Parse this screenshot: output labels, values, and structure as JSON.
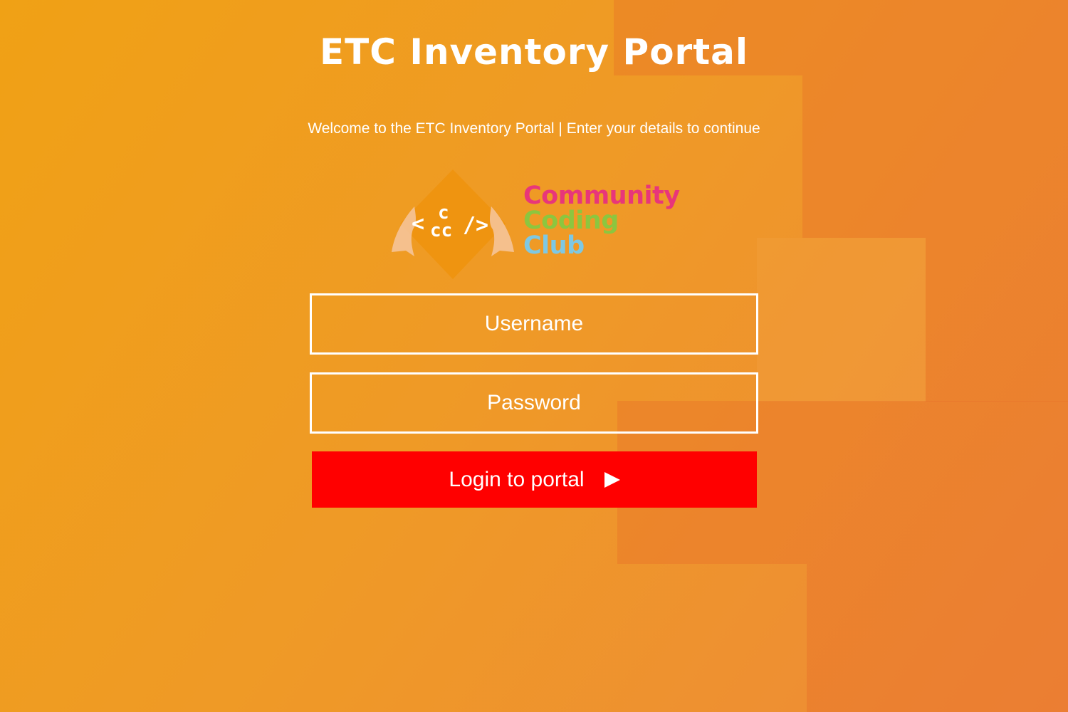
{
  "page": {
    "title": "ETC Inventory Portal",
    "subtitle": "Welcome to the ETC Inventory Portal | Enter your details to continue"
  },
  "logo": {
    "badge_text": "<ccc/>",
    "line1": "Community",
    "line2": "Coding",
    "line3": "Club"
  },
  "form": {
    "username_placeholder": "Username",
    "username_value": "",
    "password_placeholder": "Password",
    "password_value": "",
    "login_label": "Login to portal",
    "login_icon": "play-icon"
  },
  "colors": {
    "background_start": "#f0a115",
    "background_end": "#ee8a38",
    "login_button": "#ff0000",
    "logo_diamond": "#ef9410",
    "logo_community": "#e8367a",
    "logo_coding": "#8cc63f",
    "logo_club": "#7ec8e3"
  }
}
